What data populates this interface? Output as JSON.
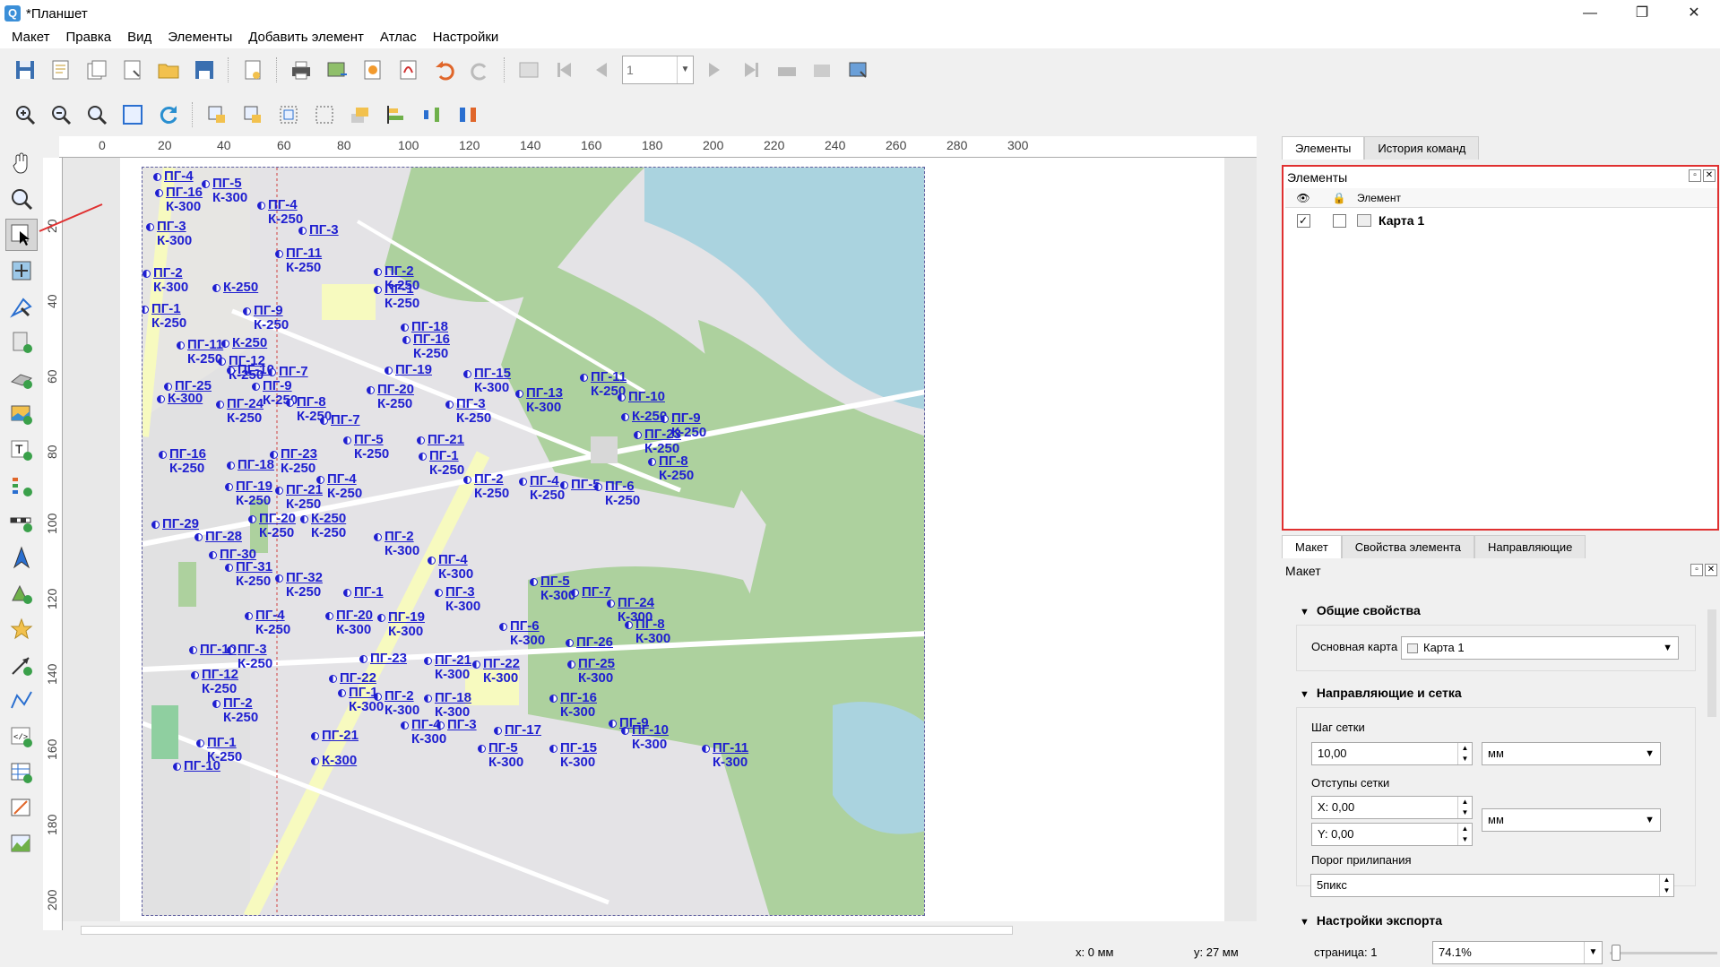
{
  "window": {
    "title": "*Планшет",
    "app_icon": "Q"
  },
  "menu": [
    "Макет",
    "Правка",
    "Вид",
    "Элементы",
    "Добавить элемент",
    "Атлас",
    "Настройки"
  ],
  "toolbar1": {
    "page_value": "1"
  },
  "ruler_top": [
    "0",
    "20",
    "40",
    "60",
    "80",
    "100",
    "120",
    "140",
    "160",
    "180",
    "200",
    "220",
    "240",
    "260",
    "280",
    "300"
  ],
  "ruler_left": [
    "20",
    "40",
    "60",
    "80",
    "100",
    "120",
    "140",
    "160",
    "180",
    "200"
  ],
  "map_labels": [
    {
      "pg": "ПГ-4",
      "k": ""
    },
    {
      "pg": "ПГ-16",
      "k": "К-300"
    },
    {
      "pg": "ПГ-5",
      "k": "К-300"
    },
    {
      "pg": "ПГ-4",
      "k": "К-250"
    },
    {
      "pg": "ПГ-3",
      "k": "К-300"
    },
    {
      "pg": "ПГ-3",
      "k": ""
    },
    {
      "pg": "ПГ-11",
      "k": "К-250"
    },
    {
      "pg": "ПГ-2",
      "k": "К-250"
    },
    {
      "pg": "ПГ-2",
      "k": "К-300"
    },
    {
      "pg": "К-250",
      "k": ""
    },
    {
      "pg": "ПГ-1",
      "k": "К-250"
    },
    {
      "pg": "ПГ-1",
      "k": "К-250"
    },
    {
      "pg": "ПГ-9",
      "k": "К-250"
    },
    {
      "pg": "ПГ-18",
      "k": ""
    },
    {
      "pg": "ПГ-16",
      "k": "К-250"
    },
    {
      "pg": "ПГ-11",
      "k": "К-250"
    },
    {
      "pg": "К-250",
      "k": ""
    },
    {
      "pg": "ПГ-12",
      "k": "К-250"
    },
    {
      "pg": "ПГ-10",
      "k": ""
    },
    {
      "pg": "ПГ-7",
      "k": ""
    },
    {
      "pg": "ПГ-19",
      "k": ""
    },
    {
      "pg": "ПГ-15",
      "k": "К-300"
    },
    {
      "pg": "ПГ-11",
      "k": "К-250"
    },
    {
      "pg": "ПГ-25",
      "k": ""
    },
    {
      "pg": "ПГ-9",
      "k": "К-250"
    },
    {
      "pg": "ПГ-20",
      "k": "К-250"
    },
    {
      "pg": "ПГ-13",
      "k": "К-300"
    },
    {
      "pg": "ПГ-10",
      "k": ""
    },
    {
      "pg": "К-300",
      "k": ""
    },
    {
      "pg": "ПГ-24",
      "k": "К-250"
    },
    {
      "pg": "ПГ-8",
      "k": "К-250"
    },
    {
      "pg": "ПГ-3",
      "k": "К-250"
    },
    {
      "pg": "К-250",
      "k": ""
    },
    {
      "pg": "ПГ-9",
      "k": "К-250"
    },
    {
      "pg": "ПГ-7",
      "k": ""
    },
    {
      "pg": "ПГ-23",
      "k": "К-250"
    },
    {
      "pg": "ПГ-5",
      "k": "К-250"
    },
    {
      "pg": "ПГ-21",
      "k": ""
    },
    {
      "pg": "ПГ-16",
      "k": "К-250"
    },
    {
      "pg": "ПГ-23",
      "k": "К-250"
    },
    {
      "pg": "ПГ-1",
      "k": "К-250"
    },
    {
      "pg": "ПГ-8",
      "k": "К-250"
    },
    {
      "pg": "ПГ-18",
      "k": ""
    },
    {
      "pg": "ПГ-4",
      "k": "К-250"
    },
    {
      "pg": "ПГ-2",
      "k": "К-250"
    },
    {
      "pg": "ПГ-4",
      "k": "К-250"
    },
    {
      "pg": "ПГ-5",
      "k": ""
    },
    {
      "pg": "ПГ-6",
      "k": "К-250"
    },
    {
      "pg": "ПГ-19",
      "k": "К-250"
    },
    {
      "pg": "ПГ-21",
      "k": "К-250"
    },
    {
      "pg": "ПГ-20",
      "k": "К-250"
    },
    {
      "pg": "К-250",
      "k": "К-250"
    },
    {
      "pg": "ПГ-29",
      "k": ""
    },
    {
      "pg": "ПГ-28",
      "k": ""
    },
    {
      "pg": "ПГ-2",
      "k": "К-300"
    },
    {
      "pg": "ПГ-30",
      "k": ""
    },
    {
      "pg": "ПГ-31",
      "k": "К-250"
    },
    {
      "pg": "ПГ-32",
      "k": "К-250"
    },
    {
      "pg": "ПГ-4",
      "k": "К-300"
    },
    {
      "pg": "ПГ-5",
      "k": "К-300"
    },
    {
      "pg": "ПГ-1",
      "k": ""
    },
    {
      "pg": "ПГ-3",
      "k": "К-300"
    },
    {
      "pg": "ПГ-7",
      "k": ""
    },
    {
      "pg": "ПГ-24",
      "k": "К-300"
    },
    {
      "pg": "ПГ-4",
      "k": "К-250"
    },
    {
      "pg": "ПГ-20",
      "k": "К-300"
    },
    {
      "pg": "ПГ-19",
      "k": "К-300"
    },
    {
      "pg": "ПГ-6",
      "k": "К-300"
    },
    {
      "pg": "ПГ-8",
      "k": "К-300"
    },
    {
      "pg": "ПГ-26",
      "k": ""
    },
    {
      "pg": "ПГ-10",
      "k": ""
    },
    {
      "pg": "ПГ-3",
      "k": "К-250"
    },
    {
      "pg": "ПГ-23",
      "k": ""
    },
    {
      "pg": "ПГ-21",
      "k": "К-300"
    },
    {
      "pg": "ПГ-22",
      "k": "К-300"
    },
    {
      "pg": "ПГ-25",
      "k": "К-300"
    },
    {
      "pg": "ПГ-12",
      "k": "К-250"
    },
    {
      "pg": "ПГ-22",
      "k": ""
    },
    {
      "pg": "ПГ-1",
      "k": "К-300"
    },
    {
      "pg": "ПГ-2",
      "k": "К-300"
    },
    {
      "pg": "ПГ-18",
      "k": "К-300"
    },
    {
      "pg": "ПГ-16",
      "k": "К-300"
    },
    {
      "pg": "ПГ-2",
      "k": "К-250"
    },
    {
      "pg": "ПГ-4",
      "k": "К-300"
    },
    {
      "pg": "ПГ-3",
      "k": ""
    },
    {
      "pg": "ПГ-17",
      "k": ""
    },
    {
      "pg": "ПГ-10",
      "k": "К-300"
    },
    {
      "pg": "ПГ-9",
      "k": ""
    },
    {
      "pg": "ПГ-21",
      "k": ""
    },
    {
      "pg": "ПГ-1",
      "k": "К-250"
    },
    {
      "pg": "К-300",
      "k": ""
    },
    {
      "pg": "ПГ-5",
      "k": "К-300"
    },
    {
      "pg": "ПГ-15",
      "k": "К-300"
    },
    {
      "pg": "ПГ-11",
      "k": "К-300"
    },
    {
      "pg": "ПГ-10",
      "k": ""
    }
  ],
  "status": {
    "x": "x: 0 мм",
    "y": "y: 27 мм",
    "page": "страница: 1",
    "zoom": "74.1%"
  },
  "right_panel": {
    "tabs": [
      "Элементы",
      "История команд"
    ],
    "elements_title": "Элементы",
    "col_element": "Элемент",
    "items": [
      {
        "name": "Карта 1",
        "visible": "✓",
        "locked": ""
      }
    ],
    "props_tabs": [
      "Макет",
      "Свойства элемента",
      "Направляющие"
    ],
    "layout_title": "Макет",
    "general_section": "Общие свойства",
    "main_map_label": "Основная карта",
    "main_map_value": "Карта 1",
    "guides_section": "Направляющие и сетка",
    "grid_step_label": "Шаг сетки",
    "grid_step_value": "10,00",
    "grid_unit": "мм",
    "grid_offset_label": "Отступы сетки",
    "offset_x": "X: 0,00",
    "offset_y": "Y: 0,00",
    "offset_unit": "мм",
    "snap_label": "Порог прилипания",
    "snap_value": "5пикс",
    "export_section": "Настройки экспорта"
  },
  "colors": {
    "label_blue": "#1f1fd0",
    "selection_red": "#e03030"
  }
}
